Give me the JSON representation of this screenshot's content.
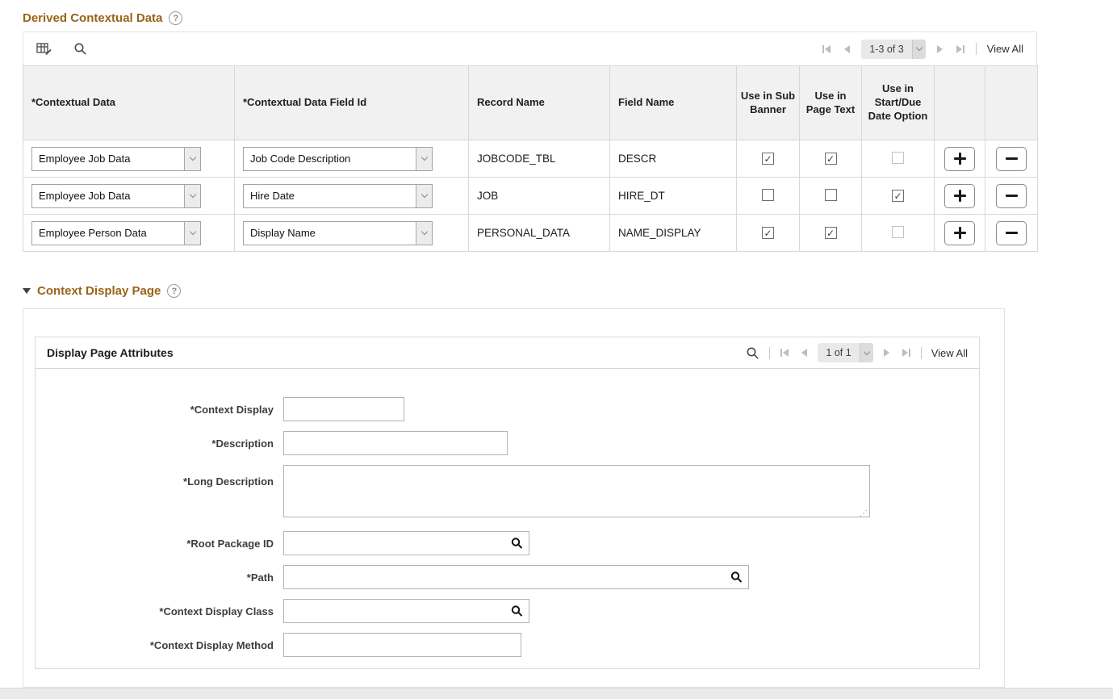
{
  "colors": {
    "heading": "#9a6317",
    "header_bg": "#f1f1f1",
    "border": "#d8d8d8",
    "pill_bg": "#e9e9e9"
  },
  "grid": {
    "title": "Derived Contextual Data",
    "toolbar": {
      "pagination": {
        "label": "1-3 of 3",
        "view_all": "View All"
      }
    },
    "columns": {
      "contextual_data": "*Contextual Data",
      "field_id": "*Contextual Data Field Id",
      "record_name": "Record Name",
      "field_name": "Field Name",
      "sub_banner": "Use in Sub Banner",
      "page_text": "Use in Page Text",
      "start_due": "Use in Start/Due Date Option"
    },
    "rows": [
      {
        "contextual_data": "Employee Job Data",
        "field_id": "Job Code Description",
        "record_name": "JOBCODE_TBL",
        "field_name": "DESCR",
        "sub_banner": true,
        "page_text": true,
        "start_due": false
      },
      {
        "contextual_data": "Employee Job Data",
        "field_id": "Hire Date",
        "record_name": "JOB",
        "field_name": "HIRE_DT",
        "sub_banner": false,
        "page_text": false,
        "start_due": true
      },
      {
        "contextual_data": "Employee Person Data",
        "field_id": "Display Name",
        "record_name": "PERSONAL_DATA",
        "field_name": "NAME_DISPLAY",
        "sub_banner": true,
        "page_text": true,
        "start_due": false
      }
    ]
  },
  "section": {
    "title": "Context Display Page",
    "box": {
      "title": "Display Page Attributes",
      "pagination": {
        "label": "1 of 1",
        "view_all": "View All"
      },
      "fields": {
        "context_display": {
          "label": "*Context Display",
          "value": ""
        },
        "description": {
          "label": "*Description",
          "value": ""
        },
        "long_description": {
          "label": "*Long Description",
          "value": ""
        },
        "root_package_id": {
          "label": "*Root Package ID",
          "value": ""
        },
        "path": {
          "label": "*Path",
          "value": ""
        },
        "context_display_class": {
          "label": "*Context Display Class",
          "value": ""
        },
        "context_display_method": {
          "label": "*Context Display Method",
          "value": ""
        }
      }
    }
  }
}
